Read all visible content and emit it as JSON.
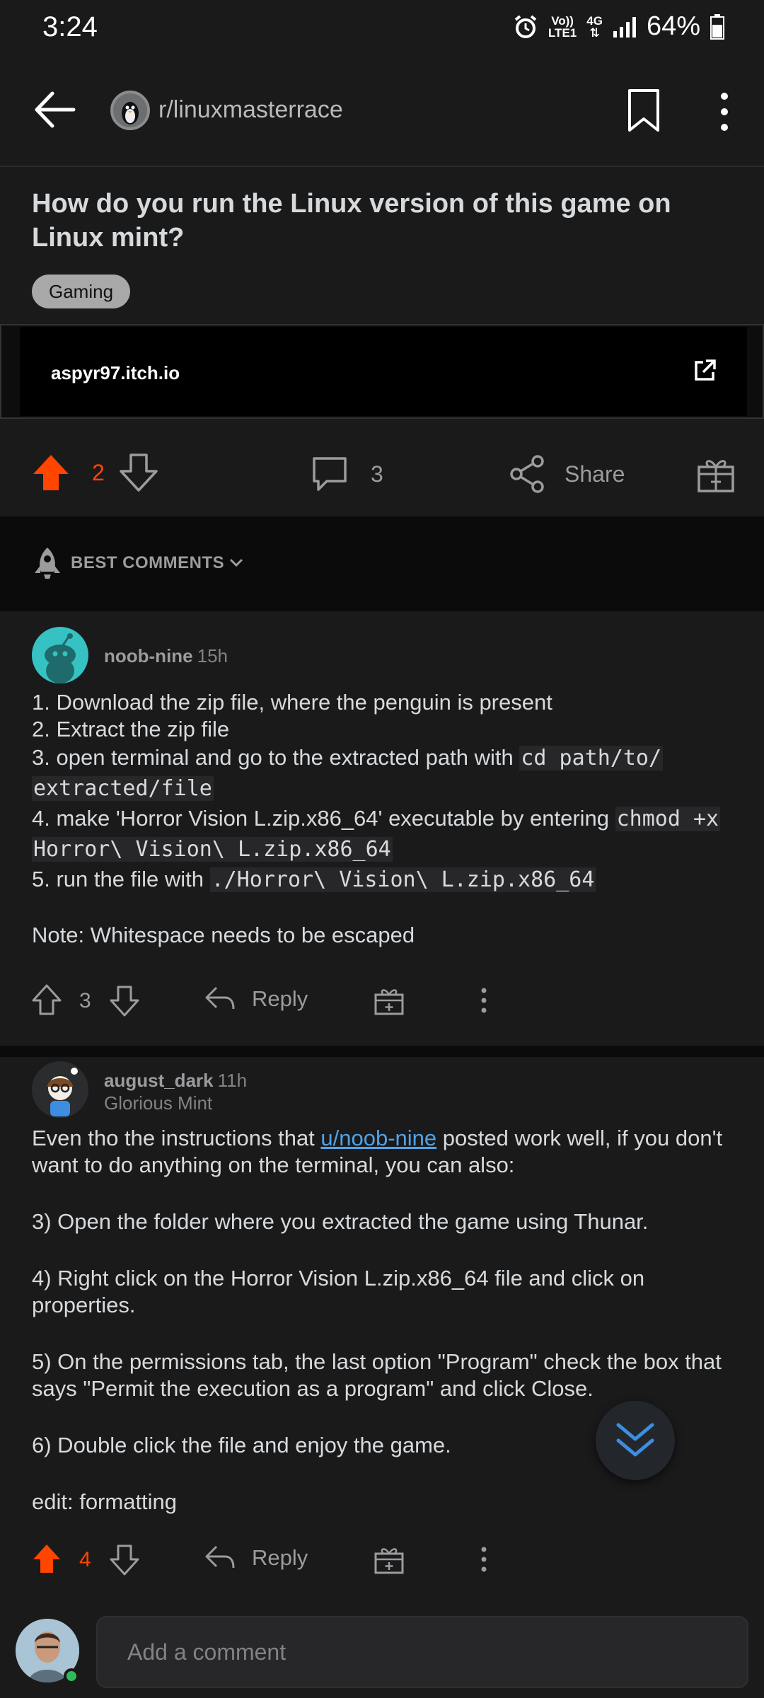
{
  "status_bar": {
    "time": "3:24",
    "network_top": "Vo))",
    "network_bottom": "LTE1",
    "data_type": "4G",
    "battery": "64%"
  },
  "header": {
    "subreddit": "r/linuxmasterrace"
  },
  "post": {
    "title": "How do you run the Linux version of this game on Linux mint?",
    "flair": "Gaming",
    "link_domain": "aspyr97.itch.io",
    "votes": "2",
    "comments_count": "3",
    "share_label": "Share"
  },
  "sort": {
    "label": "BEST COMMENTS"
  },
  "comments": [
    {
      "author": "noob-nine",
      "time": "15h",
      "lines": {
        "l1": "1. Download the zip file, where the penguin is present",
        "l2": "2. Extract the zip file",
        "l3_text": "3. open terminal and go to the extracted path with ",
        "l3_code_a": "cd path/to/",
        "l3_code_b": "extracted/file",
        "l4_text": "4. make 'Horror Vision L.zip.x86_64' executable by entering ",
        "l4_code_a": "chmod +x",
        "l4_code_b": "Horror\\ Vision\\ L.zip.x86_64",
        "l5_text": "5. run the file with ",
        "l5_code": "./Horror\\ Vision\\ L.zip.x86_64",
        "note": "Note: Whitespace needs to be escaped"
      },
      "votes": "3",
      "reply_label": "Reply"
    },
    {
      "author": "august_dark",
      "time": "11h",
      "flair": "Glorious Mint",
      "p1_before": "Even tho the instructions that ",
      "p1_link": "u/noob-nine",
      "p1_after": " posted work well, if you don't want to do anything on the terminal, you can also:",
      "p2": "3) Open the folder where you extracted the game using Thunar.",
      "p3": "4) Right click on the Horror Vision L.zip.x86_64 file and click on properties.",
      "p4": "5) On the permissions tab, the last option \"Program\" check the box that says \"Permit the execution as a program\" and click Close.",
      "p5": "6) Double click the file and enjoy the game.",
      "p6": "edit: formatting",
      "votes": "4",
      "reply_label": "Reply"
    }
  ],
  "composer": {
    "placeholder": "Add a comment"
  },
  "colors": {
    "upvote": "#ff4500",
    "link": "#4fa3e8",
    "background": "#1a1a1b"
  }
}
